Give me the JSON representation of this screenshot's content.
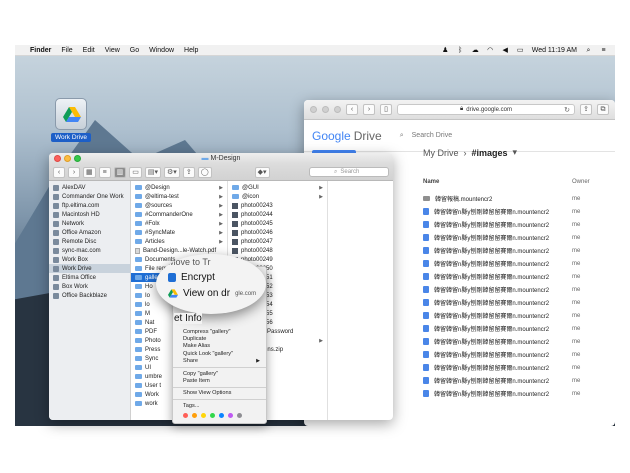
{
  "menubar": {
    "items": [
      "Finder",
      "File",
      "Edit",
      "View",
      "Go",
      "Window",
      "Help"
    ],
    "clock": "Wed 11:19 AM"
  },
  "desktop": {
    "icon_label": "Work Drive"
  },
  "safari": {
    "url": "drive.google.com",
    "logo_google": "Google",
    "logo_drive": "Drive",
    "search_placeholder": "Search Drive",
    "breadcrumb": {
      "root": "My Drive",
      "current": "#images"
    },
    "columns": {
      "name": "Name",
      "owner": "Owner"
    },
    "rows": [
      {
        "name": "韓留報稿.mountencr2",
        "owner": "me",
        "type": "folder"
      },
      {
        "name": "韓留韓留n縣y刨剛韓留留賽爾n.mountencr2",
        "owner": "me",
        "type": "file"
      },
      {
        "name": "韓留韓留n縣y刨剛韓留留賽爾n.mountencr2",
        "owner": "me",
        "type": "file"
      },
      {
        "name": "韓留韓留n縣y刨剛韓留留賽爾n.mountencr2",
        "owner": "me",
        "type": "file"
      },
      {
        "name": "韓留韓留n縣y刨剛韓留留賽爾n.mountencr2",
        "owner": "me",
        "type": "file"
      },
      {
        "name": "韓留韓留n縣y刨剛韓留留賽爾n.mountencr2",
        "owner": "me",
        "type": "file"
      },
      {
        "name": "韓留韓留n縣y刨剛韓留留賽爾n.mountencr2",
        "owner": "me",
        "type": "file"
      },
      {
        "name": "韓留韓留n縣y刨剛韓留留賽爾n.mountencr2",
        "owner": "me",
        "type": "file"
      },
      {
        "name": "韓留韓留n縣y刨剛韓留留賽爾n.mountencr2",
        "owner": "me",
        "type": "file"
      },
      {
        "name": "韓留韓留n縣y刨剛韓留留賽爾n.mountencr2",
        "owner": "me",
        "type": "file"
      },
      {
        "name": "韓留韓留n縣y刨剛韓留留賽爾n.mountencr2",
        "owner": "me",
        "type": "file"
      },
      {
        "name": "韓留韓留n縣y刨剛韓留留賽爾n.mountencr2",
        "owner": "me",
        "type": "file"
      },
      {
        "name": "韓留韓留n縣y刨剛韓留留賽爾n.mountencr2",
        "owner": "me",
        "type": "file"
      },
      {
        "name": "韓留韓留n縣y刨剛韓留留賽爾n.mountencr2",
        "owner": "me",
        "type": "file"
      },
      {
        "name": "韓留韓留n縣y刨剛韓留留賽爾n.mountencr2",
        "owner": "me",
        "type": "file"
      },
      {
        "name": "韓留韓留n縣y刨剛韓留留賽爾n.mountencr2",
        "owner": "me",
        "type": "file"
      }
    ]
  },
  "finder": {
    "title": "M-Design",
    "search_placeholder": "Search",
    "sidebar": [
      {
        "label": "AlexDAV"
      },
      {
        "label": "Commander One Work"
      },
      {
        "label": "ftp.eltima.com"
      },
      {
        "label": "Macintosh HD"
      },
      {
        "label": "Network"
      },
      {
        "label": "Office Amazon"
      },
      {
        "label": "Remote Disc"
      },
      {
        "label": "sync-mac.com"
      },
      {
        "label": "Work Box"
      },
      {
        "label": "Work Drive",
        "selected": true
      },
      {
        "label": "Eltima Office"
      },
      {
        "label": "Box Work"
      },
      {
        "label": "Office Backblaze"
      }
    ],
    "col1": [
      {
        "label": "@Design",
        "kind": "folder"
      },
      {
        "label": "@eltima-test",
        "kind": "folder"
      },
      {
        "label": "@sources",
        "kind": "folder"
      },
      {
        "label": "#CommanderOne",
        "kind": "folder"
      },
      {
        "label": "#Folx",
        "kind": "folder"
      },
      {
        "label": "#SyncMate",
        "kind": "folder"
      },
      {
        "label": "Articles",
        "kind": "folder"
      },
      {
        "label": "Band-Design...le-Watch.pdf",
        "kind": "file"
      },
      {
        "label": "Documents",
        "kind": "folder"
      },
      {
        "label": "File require to Tr",
        "kind": "folder"
      },
      {
        "label": "gallery",
        "kind": "folder",
        "selected": true
      },
      {
        "label": "Ho",
        "kind": "folder"
      },
      {
        "label": "Io",
        "kind": "folder"
      },
      {
        "label": "lo",
        "kind": "folder"
      },
      {
        "label": "M",
        "kind": "folder"
      },
      {
        "label": "Nat",
        "kind": "folder"
      },
      {
        "label": "PDF",
        "kind": "folder"
      },
      {
        "label": "Photo",
        "kind": "folder"
      },
      {
        "label": "Press",
        "kind": "folder"
      },
      {
        "label": "Sync",
        "kind": "folder"
      },
      {
        "label": "UI",
        "kind": "folder"
      },
      {
        "label": "umbre",
        "kind": "folder"
      },
      {
        "label": "User t",
        "kind": "folder"
      },
      {
        "label": "Work",
        "kind": "folder"
      },
      {
        "label": "work",
        "kind": "folder"
      }
    ],
    "col2": [
      {
        "label": "@GUI",
        "kind": "folder"
      },
      {
        "label": "@icon",
        "kind": "folder"
      },
      {
        "label": "photo00243",
        "kind": "thumb"
      },
      {
        "label": "photo00244",
        "kind": "thumb"
      },
      {
        "label": "photo00245",
        "kind": "thumb"
      },
      {
        "label": "photo00246",
        "kind": "thumb"
      },
      {
        "label": "photo00247",
        "kind": "thumb"
      },
      {
        "label": "photo00248",
        "kind": "thumb"
      },
      {
        "label": "photo00249",
        "kind": "thumb"
      },
      {
        "label": "photo00250",
        "kind": "thumb"
      },
      {
        "label": "photo00251",
        "kind": "thumb"
      },
      {
        "label": "photo00252",
        "kind": "thumb"
      },
      {
        "label": "photo00253",
        "kind": "thumb"
      },
      {
        "label": "photo00254",
        "kind": "thumb"
      },
      {
        "label": "photo00255",
        "kind": "thumb"
      },
      {
        "label": "photo00256",
        "kind": "thumb"
      },
      {
        "label": "over PDF Password",
        "kind": "file"
      },
      {
        "label": "cMate",
        "kind": "folder"
      },
      {
        "label": "hotoScreens.zip",
        "kind": "file"
      }
    ]
  },
  "context_menu": {
    "items": [
      "Compress \"gallery\"",
      "Duplicate",
      "Make Alias",
      "Quick Look \"gallery\"",
      "Share",
      "Copy \"gallery\"",
      "Paste Item",
      "Show View Options",
      "Tags..."
    ],
    "tags": [
      "#ff5f57",
      "#ff9f0a",
      "#ffd60a",
      "#32d74b",
      "#0a84ff",
      "#bf5af2",
      "#8e8e93"
    ]
  },
  "zoom": {
    "top_text": "Move to Tr",
    "encrypt": "Encrypt",
    "view_on": "View on dr",
    "url_fragment": "gle.com",
    "get_info": "et Info"
  }
}
